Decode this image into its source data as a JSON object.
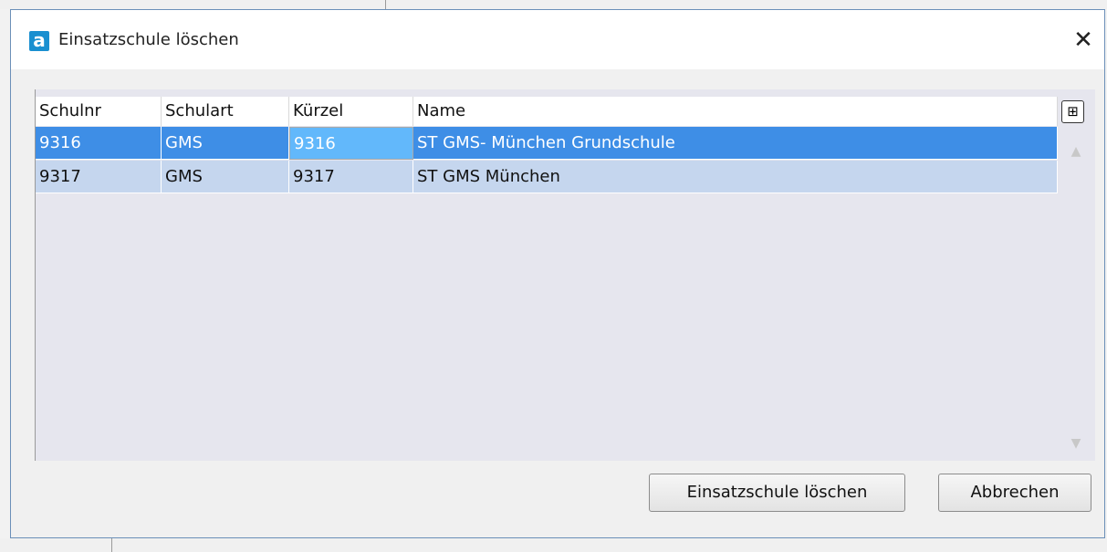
{
  "window": {
    "title": "Einsatzschule löschen",
    "app_icon_glyph": "a",
    "close_glyph": "✕"
  },
  "table": {
    "columns": [
      "Schulnr",
      "Schulart",
      "Kürzel",
      "Name"
    ],
    "rows": [
      {
        "schulnr": "9316",
        "schulart": "GMS",
        "kuerzel": "9316",
        "name": "ST GMS- München Grundschule",
        "selected": true
      },
      {
        "schulnr": "9317",
        "schulart": "GMS",
        "kuerzel": "9317",
        "name": "ST GMS München",
        "selected": false
      }
    ],
    "column_chooser_glyph": "⊞",
    "scroll_up_glyph": "▲",
    "scroll_down_glyph": "▼"
  },
  "buttons": {
    "delete_label": "Einsatzschule löschen",
    "cancel_label": "Abbrechen"
  },
  "colors": {
    "selected_row": "#3e8ee6",
    "focused_cell": "#62b8fb",
    "normal_row": "#c5d6ee",
    "app_icon": "#1a8fd0"
  }
}
